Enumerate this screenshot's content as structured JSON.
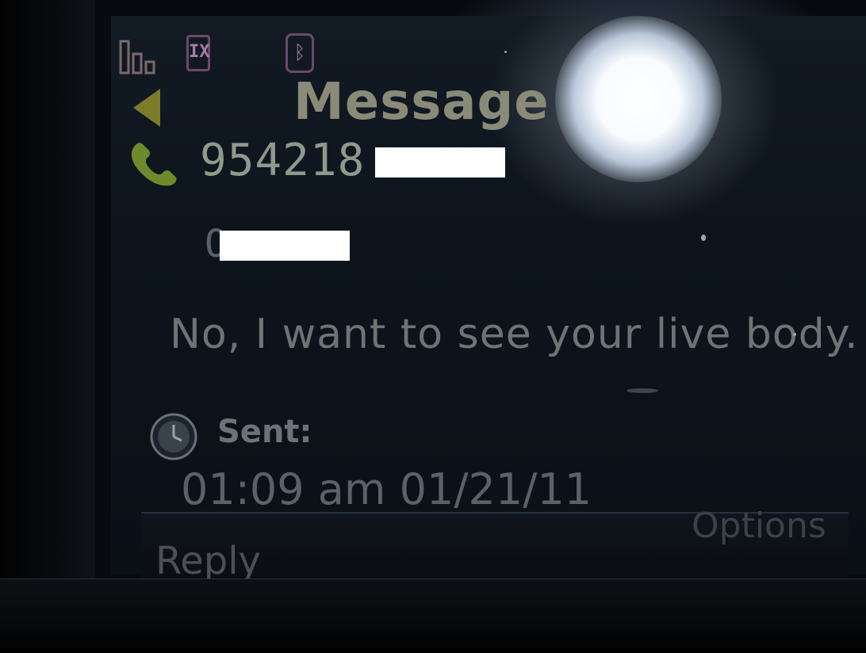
{
  "screen": {
    "title": "Message",
    "status_icons": [
      "signal-icon",
      "ex-icon",
      "bluetooth-icon"
    ],
    "status_ex_glyph": "IX",
    "status_bt_glyph": "ᛒ",
    "contact": {
      "number_visible": "954218",
      "name_prefix": "O"
    },
    "message_text": "No, I want to see your live body.",
    "sent": {
      "label": "Sent:",
      "time": "01:09 am 01/21/11"
    },
    "softkeys": {
      "left": "Reply",
      "right": "Options"
    }
  },
  "colors": {
    "title": "#8a8a78",
    "phone_icon": "#7c8a3a",
    "text": "#707375",
    "status_icon": "#a67ca6"
  }
}
